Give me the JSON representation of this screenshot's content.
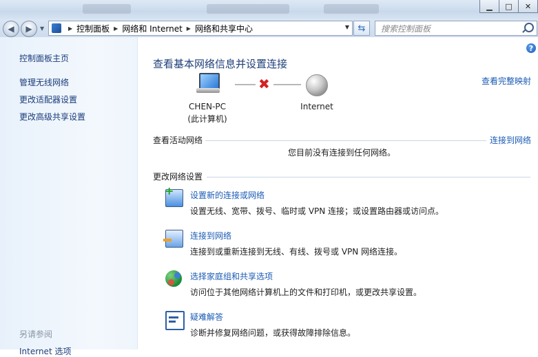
{
  "window": {
    "min": "▁",
    "max": "□",
    "close": "✕"
  },
  "nav": {
    "back": "◀",
    "forward": "▶",
    "breadcrumb": [
      "控制面板",
      "网络和 Internet",
      "网络和共享中心"
    ],
    "search_placeholder": "搜索控制面板"
  },
  "sidebar": {
    "home": "控制面板主页",
    "items": [
      "管理无线网络",
      "更改适配器设置",
      "更改高级共享设置"
    ],
    "see_also": "另请参阅",
    "see_also_items": [
      "Internet 选项"
    ]
  },
  "main": {
    "help": "?",
    "title": "查看基本网络信息并设置连接",
    "full_map": "查看完整映射",
    "pc_name": "CHEN-PC",
    "pc_sub": "(此计算机)",
    "internet_label": "Internet",
    "active_networks": "查看活动网络",
    "connect_link": "连接到网络",
    "no_connection": "您目前没有连接到任何网络。",
    "change_settings": "更改网络设置",
    "tasks": [
      {
        "title": "设置新的连接或网络",
        "desc": "设置无线、宽带、拨号、临时或 VPN 连接；或设置路由器或访问点。"
      },
      {
        "title": "连接到网络",
        "desc": "连接到或重新连接到无线、有线、拨号或 VPN 网络连接。"
      },
      {
        "title": "选择家庭组和共享选项",
        "desc": "访问位于其他网络计算机上的文件和打印机，或更改共享设置。"
      },
      {
        "title": "疑难解答",
        "desc": "诊断并修复网络问题，或获得故障排除信息。"
      }
    ]
  },
  "colors": {
    "link": "#1a5bb5",
    "title": "#1e3f7a",
    "sidebar_link": "#1a3c7a",
    "error_x": "#d42222"
  }
}
